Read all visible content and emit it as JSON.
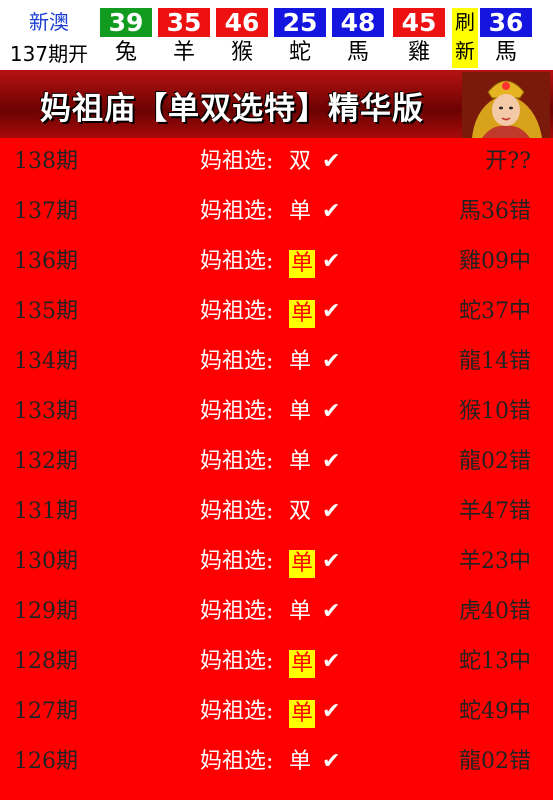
{
  "header": {
    "brand_line1": "新澳",
    "brand_line2": "137期开",
    "balls": [
      {
        "num": "39",
        "zodiac": "兔",
        "color": "#119c1f"
      },
      {
        "num": "35",
        "zodiac": "羊",
        "color": "#ee1111"
      },
      {
        "num": "46",
        "zodiac": "猴",
        "color": "#ee1111"
      },
      {
        "num": "25",
        "zodiac": "蛇",
        "color": "#1515e0"
      },
      {
        "num": "48",
        "zodiac": "馬",
        "color": "#1515e0"
      },
      {
        "num": "45",
        "zodiac": "雞",
        "color": "#ee1111"
      }
    ],
    "refresh_l1": "刷",
    "refresh_l2": "新",
    "special": {
      "num": "36",
      "zodiac": "馬",
      "color": "#1515e0"
    }
  },
  "banner": {
    "title": "妈祖庙【单双选特】精华版"
  },
  "rows": [
    {
      "issue": "138期",
      "label": "妈祖选:",
      "pick": "双",
      "highlight": false,
      "check": "✔",
      "result": "开??"
    },
    {
      "issue": "137期",
      "label": "妈祖选:",
      "pick": "单",
      "highlight": false,
      "check": "✔",
      "result": "馬36错"
    },
    {
      "issue": "136期",
      "label": "妈祖选:",
      "pick": "单",
      "highlight": true,
      "check": "✔",
      "result": "雞09中"
    },
    {
      "issue": "135期",
      "label": "妈祖选:",
      "pick": "单",
      "highlight": true,
      "check": "✔",
      "result": "蛇37中"
    },
    {
      "issue": "134期",
      "label": "妈祖选:",
      "pick": "单",
      "highlight": false,
      "check": "✔",
      "result": "龍14错"
    },
    {
      "issue": "133期",
      "label": "妈祖选:",
      "pick": "单",
      "highlight": false,
      "check": "✔",
      "result": "猴10错"
    },
    {
      "issue": "132期",
      "label": "妈祖选:",
      "pick": "单",
      "highlight": false,
      "check": "✔",
      "result": "龍02错"
    },
    {
      "issue": "131期",
      "label": "妈祖选:",
      "pick": "双",
      "highlight": false,
      "check": "✔",
      "result": "羊47错"
    },
    {
      "issue": "130期",
      "label": "妈祖选:",
      "pick": "单",
      "highlight": true,
      "check": "✔",
      "result": "羊23中"
    },
    {
      "issue": "129期",
      "label": "妈祖选:",
      "pick": "单",
      "highlight": false,
      "check": "✔",
      "result": "虎40错"
    },
    {
      "issue": "128期",
      "label": "妈祖选:",
      "pick": "单",
      "highlight": true,
      "check": "✔",
      "result": "蛇13中"
    },
    {
      "issue": "127期",
      "label": "妈祖选:",
      "pick": "单",
      "highlight": true,
      "check": "✔",
      "result": "蛇49中"
    },
    {
      "issue": "126期",
      "label": "妈祖选:",
      "pick": "单",
      "highlight": false,
      "check": "✔",
      "result": "龍02错"
    }
  ]
}
